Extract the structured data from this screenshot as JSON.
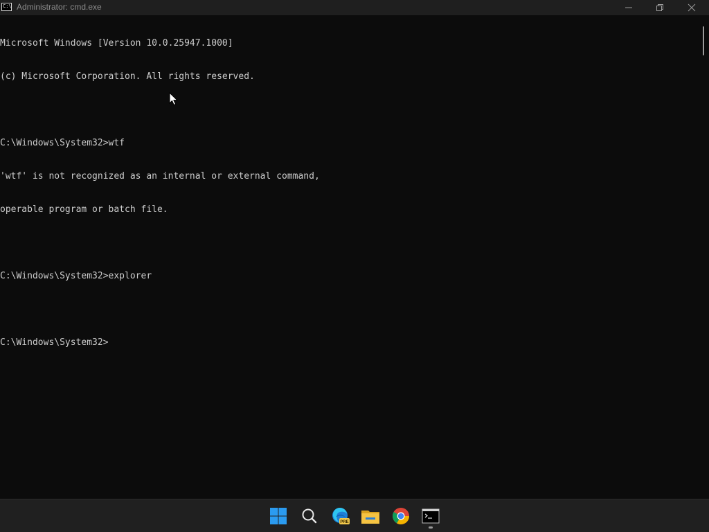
{
  "window": {
    "title": "Administrator: cmd.exe",
    "title_icon_text": "C:\\"
  },
  "console": {
    "lines": [
      "Microsoft Windows [Version 10.0.25947.1000]",
      "(c) Microsoft Corporation. All rights reserved.",
      "",
      "C:\\Windows\\System32>wtf",
      "'wtf' is not recognized as an internal or external command,",
      "operable program or batch file.",
      "",
      "C:\\Windows\\System32>explorer",
      "",
      "C:\\Windows\\System32>"
    ]
  },
  "taskbar": {
    "icons": [
      "windows-start-icon",
      "search-icon",
      "edge-preview-icon",
      "file-explorer-icon",
      "chrome-icon",
      "terminal-icon"
    ],
    "edge_badge": "PRE"
  },
  "colors": {
    "console_bg": "#0c0c0c",
    "console_text": "#cccccc",
    "titlebar_bg": "#1f1f1f",
    "taskbar_bg": "#202020",
    "start_blue": "#2b9bf0",
    "folder_yellow": "#f5c342"
  }
}
